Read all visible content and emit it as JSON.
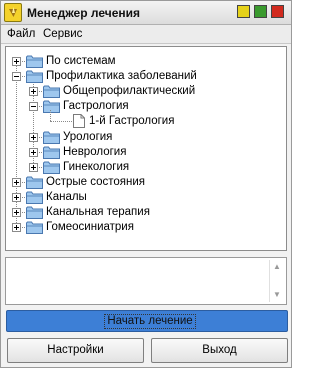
{
  "window": {
    "title": "Менеджер лечения",
    "colors": {
      "minimize": "#e6d21a",
      "maximize": "#3a9a2e",
      "close": "#d12a1e",
      "start_button": "#3d7fd6"
    }
  },
  "menu": {
    "file": "Файл",
    "service": "Сервис"
  },
  "tree": {
    "nodes": [
      {
        "label": "По системам",
        "level": 0,
        "expander": "plus",
        "icon": "folder-icon"
      },
      {
        "label": "Профилактика заболеваний",
        "level": 0,
        "expander": "minus",
        "icon": "folder-icon"
      },
      {
        "label": "Общепрофилактический",
        "level": 1,
        "expander": "plus",
        "icon": "folder-icon"
      },
      {
        "label": "Гастрология",
        "level": 1,
        "expander": "minus",
        "icon": "folder-icon"
      },
      {
        "label": "1-й Гастрология",
        "level": 2,
        "expander": "none",
        "icon": "document-icon"
      },
      {
        "label": "Урология",
        "level": 1,
        "expander": "plus",
        "icon": "folder-icon"
      },
      {
        "label": "Неврология",
        "level": 1,
        "expander": "plus",
        "icon": "folder-icon"
      },
      {
        "label": "Гинекология",
        "level": 1,
        "expander": "plus",
        "icon": "folder-icon"
      },
      {
        "label": "Острые состояния",
        "level": 0,
        "expander": "plus",
        "icon": "folder-icon"
      },
      {
        "label": "Каналы",
        "level": 0,
        "expander": "plus",
        "icon": "folder-icon"
      },
      {
        "label": "Канальная терапия",
        "level": 0,
        "expander": "plus",
        "icon": "folder-icon"
      },
      {
        "label": "Гомеосиниатрия",
        "level": 0,
        "expander": "plus",
        "icon": "folder-icon"
      }
    ]
  },
  "text_area": {
    "value": ""
  },
  "buttons": {
    "start": "Начать лечение",
    "settings": "Настройки",
    "exit": "Выход"
  }
}
